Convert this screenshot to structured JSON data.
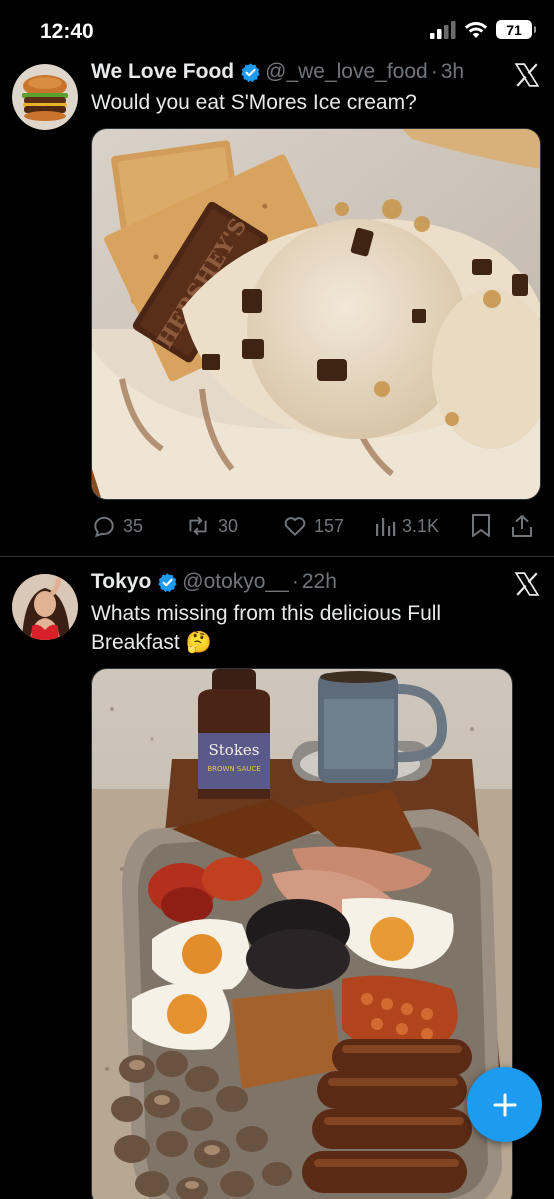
{
  "status_bar": {
    "time": "12:40",
    "battery": "71"
  },
  "tweets": [
    {
      "display_name": "We Love Food",
      "handle": "@_we_love_food",
      "dot": "·",
      "time": "3h",
      "text": "Would you eat S'Mores Ice cream?",
      "chocolate_label": "HERSHEY'S",
      "metrics": {
        "replies": "35",
        "reposts": "30",
        "likes": "157",
        "views": "3.1K"
      }
    },
    {
      "display_name": "Tokyo",
      "handle": "@otokyo__",
      "dot": "·",
      "time": "22h",
      "text": "Whats missing from this delicious Full Breakfast 🤔",
      "sauce_label": "Stokes",
      "sauce_sub": "BROWN SAUCE"
    }
  ],
  "colors": {
    "accent": "#1d9bf0",
    "muted": "#71767b",
    "background": "#000000",
    "text": "#e7e9ea"
  },
  "icons": [
    "signal-icon",
    "wifi-icon",
    "battery-icon",
    "verified-badge-icon",
    "x-logo-icon",
    "reply-icon",
    "repost-icon",
    "like-icon",
    "views-icon",
    "bookmark-icon",
    "share-icon",
    "plus-icon"
  ]
}
